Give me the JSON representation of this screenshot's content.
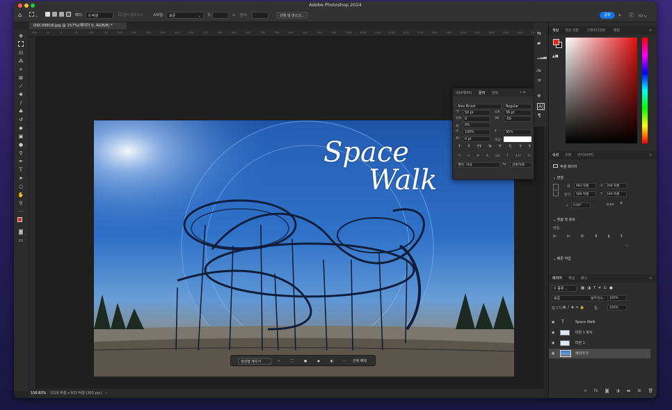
{
  "app_title": "Adobe Photoshop 2024",
  "options": {
    "feather_label": "페더:",
    "feather_value": "0 픽셀",
    "antialias_label": "앤티 앨리어스",
    "style_label": "스타일:",
    "style_value": "표준",
    "width_label": "폭:",
    "height_label": "높이:",
    "select_mask_button": "선택 및 마스크...",
    "share_button": "공유"
  },
  "document_tab": "DSC09818.jpg @ 157%(레이어 0, RGB/8) *",
  "ruler_numbers": [
    "100",
    "50",
    "0",
    "50",
    "100",
    "150",
    "200",
    "250",
    "300",
    "350",
    "400",
    "450",
    "500",
    "550",
    "600",
    "650",
    "700",
    "750",
    "800",
    "850",
    "900",
    "950",
    "1000",
    "1050",
    "1100",
    "1150",
    "1200",
    "1250",
    "1300",
    "1350",
    "1400",
    "1450",
    "1500",
    "1550",
    "1600",
    "1650"
  ],
  "image_text": {
    "line1": "Space",
    "line2": "Walk"
  },
  "context_bar": {
    "generative_fill": "생성형 채우기",
    "deselect": "선택 해제",
    "more": "···"
  },
  "status": {
    "zoom": "156.83%",
    "doc_info": "1528 픽셀 x 933 픽셀 (300 ppi)",
    "arrow": "›"
  },
  "character_panel": {
    "tabs": [
      "내비게이터",
      "문자",
      "단락"
    ],
    "font_family": "Alex Brush",
    "font_style": "Regular",
    "size": "50 pt",
    "leading": "36 pt",
    "kerning_label": "V/A",
    "kerning": "0",
    "tracking": "-50",
    "tsume": "0%",
    "vscale": "100%",
    "hscale": "95%",
    "baseline": "0 pt",
    "color_label": "색상:",
    "typo_buttons": [
      "T",
      "T",
      "TT",
      "Tr",
      "T'",
      "T,",
      "T",
      "T"
    ],
    "ot_buttons": [
      "fi",
      "ơ",
      "st",
      "A",
      "ad",
      "T",
      "1st",
      "½"
    ],
    "language": "영어: 미국",
    "aa_label": "ªa",
    "aa_method": "선명하게"
  },
  "color_panel": {
    "tabs": [
      "색상",
      "색상 견본",
      "그레이디언트",
      "패턴"
    ],
    "fg": "#e02a1a",
    "bg": "#111111"
  },
  "properties_panel": {
    "tabs": [
      "속성",
      "조정",
      "라이브러리"
    ],
    "layer_type": "픽셀 레이어",
    "transform_title": "변형",
    "w_label": "폭",
    "w": "983 픽셀",
    "x_label": "X",
    "x": "268 픽셀",
    "h_label": "높이",
    "h": "589 픽셀",
    "y_label": "Y",
    "y": "249 픽셀",
    "angle": "0.00°",
    "align_title": "맞춤 및 분포",
    "align_label": "맞춤:",
    "quick_title": "빠른 작업"
  },
  "layers_panel": {
    "tabs": [
      "레이어",
      "채널",
      "패스"
    ],
    "kind": "종류",
    "blend_mode": "표준",
    "opacity_label": "불투명도:",
    "opacity": "100%",
    "lock_label": "잠그기:",
    "fill_label": "칠:",
    "fill": "100%",
    "layers": [
      {
        "name": "Space     Walk",
        "kind": "text"
      },
      {
        "name": "타원 1 복사",
        "kind": "shape"
      },
      {
        "name": "타원 1",
        "kind": "shape"
      },
      {
        "name": "레이어 0",
        "kind": "image"
      }
    ],
    "footer_fx": "fx"
  }
}
